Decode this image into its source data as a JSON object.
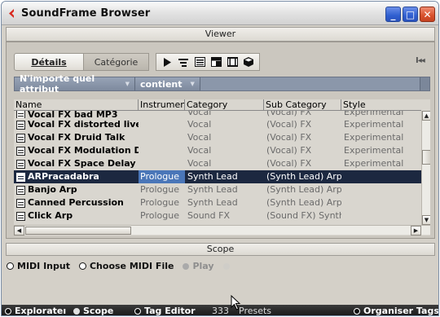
{
  "window": {
    "title": "SoundFrame Browser",
    "buttons": {
      "minimize": "_",
      "maximize": "□",
      "close": "✕"
    }
  },
  "viewer": {
    "label": "Viewer"
  },
  "tabs": {
    "details": "Détails",
    "category": "Catégorie"
  },
  "toolbar": {
    "nav_end_label": "I◂◂"
  },
  "filter": {
    "attribute": "N'importe quel attribut",
    "operator": "contient",
    "value": ""
  },
  "table": {
    "columns": {
      "name": "Name",
      "instrument": "Instrument",
      "category": "Category",
      "sub_category": "Sub Category",
      "style": "Style"
    },
    "clipped_row": {
      "name": "Vocal FX bad MP3",
      "instrument": "",
      "category": "Vocal",
      "sub_category": "(Vocal) FX",
      "style": "Experimental"
    },
    "rows": [
      {
        "name": "Vocal FX distorted live",
        "instrument": "",
        "category": "Vocal",
        "sub_category": "(Vocal) FX",
        "style": "Experimental"
      },
      {
        "name": "Vocal FX Druid Talk",
        "instrument": "",
        "category": "Vocal",
        "sub_category": "(Vocal) FX",
        "style": "Experimental"
      },
      {
        "name": "Vocal FX Modulation D",
        "instrument": "",
        "category": "Vocal",
        "sub_category": "(Vocal) FX",
        "style": "Experimental"
      },
      {
        "name": "Vocal FX Space Delay",
        "instrument": "",
        "category": "Vocal",
        "sub_category": "(Vocal) FX",
        "style": "Experimental"
      },
      {
        "name": "ARPracadabra",
        "instrument": "Prologue",
        "category": "Synth Lead",
        "sub_category": "(Synth Lead) Arpeggi",
        "style": ""
      },
      {
        "name": "Banjo Arp",
        "instrument": "Prologue",
        "category": "Synth Lead",
        "sub_category": "(Synth Lead) Arpeggi",
        "style": ""
      },
      {
        "name": "Canned Percussion",
        "instrument": "Prologue",
        "category": "Synth Lead",
        "sub_category": "(Synth Lead) Arpeggi",
        "style": ""
      },
      {
        "name": "Click Arp",
        "instrument": "Prologue",
        "category": "Sound FX",
        "sub_category": "(Sound FX) Synthetic",
        "style": ""
      }
    ],
    "selected_index": 4
  },
  "scope": {
    "label": "Scope",
    "options": {
      "midi_input": "MIDI Input",
      "choose_midi_file": "Choose MIDI File",
      "play": "Play"
    }
  },
  "statusbar": {
    "explorer": "Explorateı",
    "scope": "Scope",
    "tag_editor": "Tag Editor",
    "presets_count": "333",
    "presets_label": "Presets",
    "organizer": "Organiser Tags"
  },
  "colors": {
    "selection": "#1c2840",
    "selection_instrument": "#4a76b8",
    "filter_bar": "#8b97aa",
    "status_bar": "#1a1a1a"
  },
  "icons": {
    "title": "cubase-logo-icon",
    "view_modes": [
      "play-icon",
      "list-icon",
      "details-icon",
      "card-icon",
      "film-icon",
      "cube-icon"
    ],
    "preset": "preset-document-icon"
  }
}
